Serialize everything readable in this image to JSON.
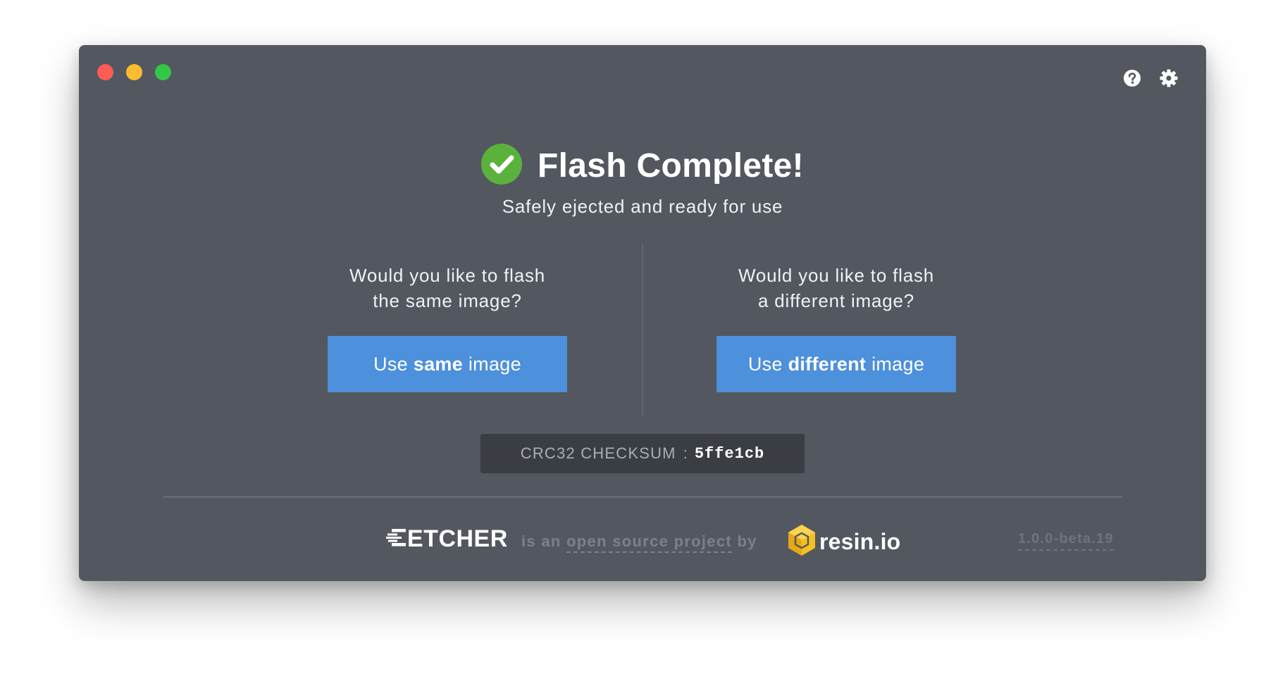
{
  "window": {
    "controls": {
      "close_color": "#fc5c56",
      "minimize_color": "#fdbc2e",
      "maximize_color": "#33c748"
    },
    "header_icons": [
      "help-icon",
      "settings-gear-icon"
    ]
  },
  "status": {
    "icon": "success-check-icon",
    "icon_color": "#5ab23d",
    "title": "Flash Complete!",
    "subtitle": "Safely ejected and ready for use"
  },
  "options": {
    "same": {
      "question_line1": "Would you like to flash",
      "question_line2": "the same image?",
      "button_prefix": "Use",
      "button_bold": "same",
      "button_suffix": "image"
    },
    "different": {
      "question_line1": "Would you like to flash",
      "question_line2": "a different image?",
      "button_prefix": "Use",
      "button_bold": "different",
      "button_suffix": "image"
    },
    "button_color": "#4d90db"
  },
  "checksum": {
    "label": "CRC32 CHECKSUM",
    "separator": ":",
    "value": "5ffe1cb"
  },
  "footer": {
    "app_logo": "ETCHER",
    "text_prefix": "is an",
    "link_text": "open source project",
    "text_suffix": "by",
    "company_logo": "resin.io",
    "company_logo_color": "#f5c022",
    "version": "1.0.0-beta.19"
  }
}
